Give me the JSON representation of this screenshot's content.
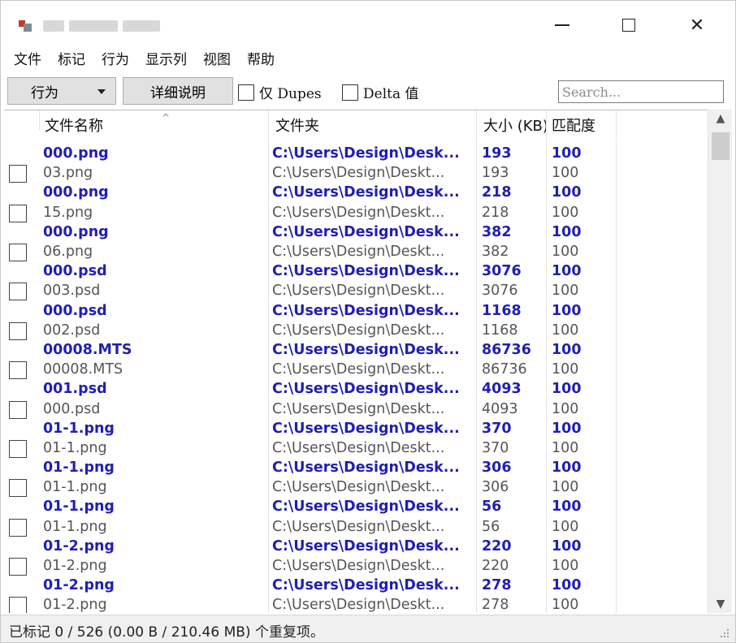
{
  "window": {
    "close_glyph": "✕"
  },
  "menu": [
    "文件",
    "标记",
    "行为",
    "显示列",
    "视图",
    "帮助"
  ],
  "toolbar": {
    "action_dropdown": "行为",
    "details_button": "详细说明",
    "only_dupes_label": "仅 Dupes",
    "delta_label": "Delta 值",
    "search_placeholder": "Search..."
  },
  "columns": {
    "filename": "文件名称",
    "folder": "文件夹",
    "size": "大小 (KB)",
    "match": "匹配度"
  },
  "rows": [
    {
      "type": "group",
      "name": "000.png",
      "folder": "C:\\Users\\Design\\Desk...",
      "size": "193",
      "match": "100"
    },
    {
      "type": "item",
      "name": "03.png",
      "folder": "C:\\Users\\Design\\Deskt...",
      "size": "193",
      "match": "100"
    },
    {
      "type": "group",
      "name": "000.png",
      "folder": "C:\\Users\\Design\\Desk...",
      "size": "218",
      "match": "100"
    },
    {
      "type": "item",
      "name": "15.png",
      "folder": "C:\\Users\\Design\\Deskt...",
      "size": "218",
      "match": "100"
    },
    {
      "type": "group",
      "name": "000.png",
      "folder": "C:\\Users\\Design\\Desk...",
      "size": "382",
      "match": "100"
    },
    {
      "type": "item",
      "name": "06.png",
      "folder": "C:\\Users\\Design\\Deskt...",
      "size": "382",
      "match": "100"
    },
    {
      "type": "group",
      "name": "000.psd",
      "folder": "C:\\Users\\Design\\Desk...",
      "size": "3076",
      "match": "100"
    },
    {
      "type": "item",
      "name": "003.psd",
      "folder": "C:\\Users\\Design\\Deskt...",
      "size": "3076",
      "match": "100"
    },
    {
      "type": "group",
      "name": "000.psd",
      "folder": "C:\\Users\\Design\\Desk...",
      "size": "1168",
      "match": "100"
    },
    {
      "type": "item",
      "name": "002.psd",
      "folder": "C:\\Users\\Design\\Deskt...",
      "size": "1168",
      "match": "100"
    },
    {
      "type": "group",
      "name": "00008.MTS",
      "folder": "C:\\Users\\Design\\Desk...",
      "size": "86736",
      "match": "100"
    },
    {
      "type": "item",
      "name": "00008.MTS",
      "folder": "C:\\Users\\Design\\Deskt...",
      "size": "86736",
      "match": "100"
    },
    {
      "type": "group",
      "name": "001.psd",
      "folder": "C:\\Users\\Design\\Desk...",
      "size": "4093",
      "match": "100"
    },
    {
      "type": "item",
      "name": "000.psd",
      "folder": "C:\\Users\\Design\\Deskt...",
      "size": "4093",
      "match": "100"
    },
    {
      "type": "group",
      "name": "01-1.png",
      "folder": "C:\\Users\\Design\\Desk...",
      "size": "370",
      "match": "100"
    },
    {
      "type": "item",
      "name": "01-1.png",
      "folder": "C:\\Users\\Design\\Deskt...",
      "size": "370",
      "match": "100"
    },
    {
      "type": "group",
      "name": "01-1.png",
      "folder": "C:\\Users\\Design\\Desk...",
      "size": "306",
      "match": "100"
    },
    {
      "type": "item",
      "name": "01-1.png",
      "folder": "C:\\Users\\Design\\Deskt...",
      "size": "306",
      "match": "100"
    },
    {
      "type": "group",
      "name": "01-1.png",
      "folder": "C:\\Users\\Design\\Desk...",
      "size": "56",
      "match": "100"
    },
    {
      "type": "item",
      "name": "01-1.png",
      "folder": "C:\\Users\\Design\\Deskt...",
      "size": "56",
      "match": "100"
    },
    {
      "type": "group",
      "name": "01-2.png",
      "folder": "C:\\Users\\Design\\Desk...",
      "size": "220",
      "match": "100"
    },
    {
      "type": "item",
      "name": "01-2.png",
      "folder": "C:\\Users\\Design\\Deskt...",
      "size": "220",
      "match": "100"
    },
    {
      "type": "group",
      "name": "01-2.png",
      "folder": "C:\\Users\\Design\\Desk...",
      "size": "278",
      "match": "100"
    },
    {
      "type": "item",
      "name": "01-2.png",
      "folder": "C:\\Users\\Design\\Deskt...",
      "size": "278",
      "match": "100"
    }
  ],
  "status": {
    "text": "已标记 0 / 526 (0.00 B / 210.46 MB) 个重复项。"
  },
  "colors": {
    "group_text": "#1f1fb4",
    "item_text": "#555555"
  }
}
